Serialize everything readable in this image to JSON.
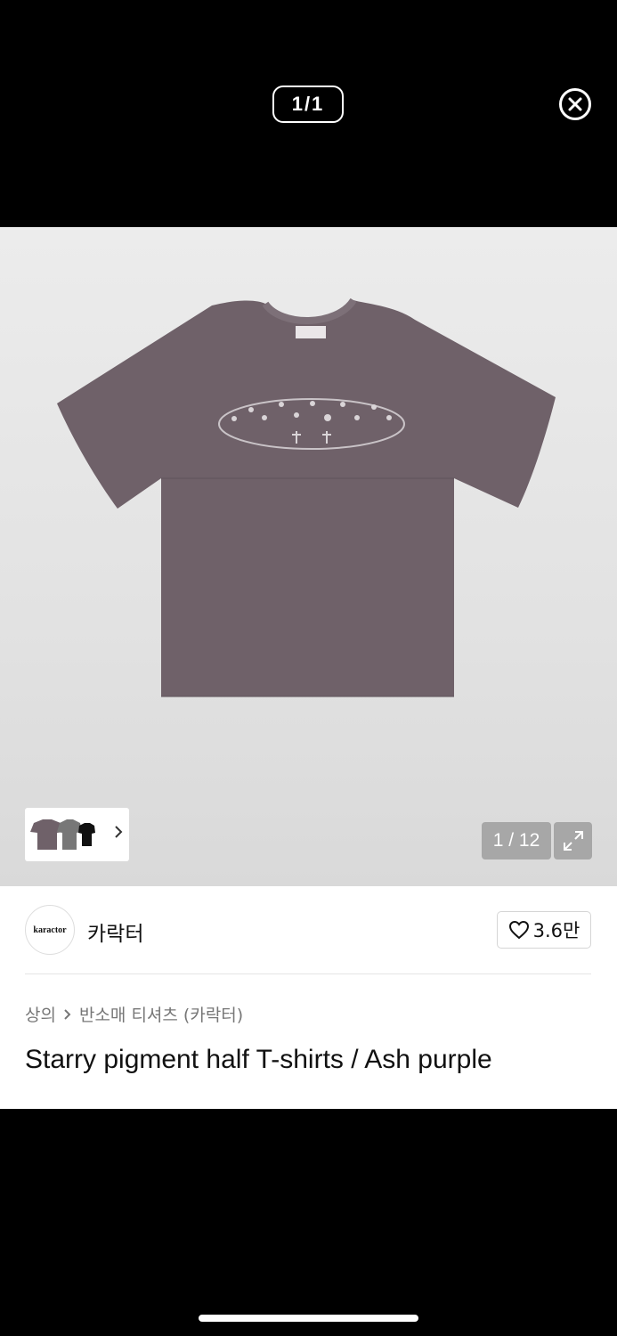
{
  "viewer": {
    "page_indicator": "1/1",
    "close_icon": "close-circle-icon"
  },
  "gallery": {
    "image_counter": "1 / 12",
    "expand_icon": "expand-arrows-icon",
    "thumbnail_next_icon": "chevron-right-icon"
  },
  "brand": {
    "logo_text": "karactor",
    "name": "카락터"
  },
  "likes": {
    "icon": "heart-outline-icon",
    "count": "3.6만"
  },
  "breadcrumb": {
    "category": "상의",
    "separator_icon": "chevron-right-icon",
    "subcategory": "반소매 티셔츠 (카락터)"
  },
  "product": {
    "title": "Starry pigment half T-shirts / Ash purple"
  },
  "colors": {
    "shirt": "#6f6169",
    "background": "#e6e6e6",
    "text": "#111111",
    "muted_text": "#777777"
  }
}
